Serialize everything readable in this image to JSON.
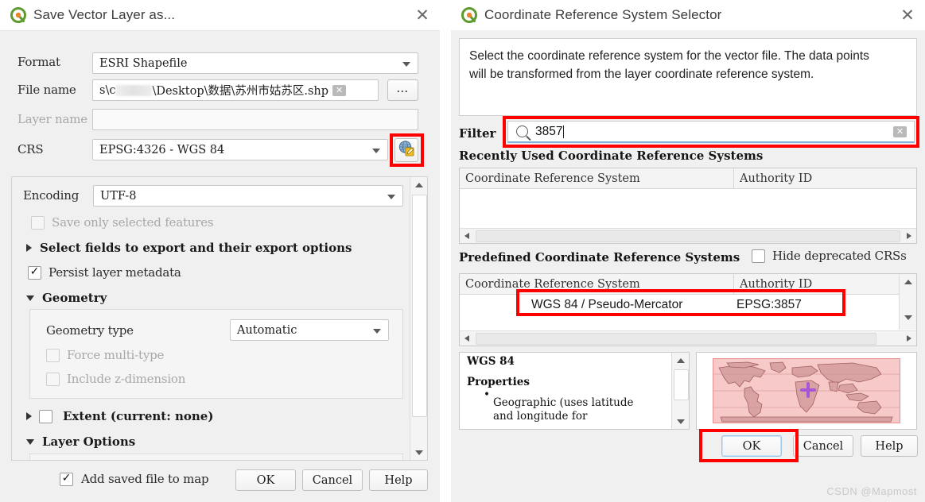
{
  "left_dialog": {
    "title": "Save Vector Layer as...",
    "close_label": "✕",
    "fields": {
      "format_label": "Format",
      "format_value": "ESRI Shapefile",
      "filename_label": "File name",
      "filename_prefix": "s\\c",
      "filename_suffix": "\\Desktop\\数据\\苏州市姑苏区.shp",
      "browse_label": "…",
      "layername_label": "Layer name",
      "layername_value": "",
      "crs_label": "CRS",
      "crs_value": "EPSG:4326 - WGS 84",
      "crs_picker_icon": "globe-pencil-icon"
    },
    "options": {
      "encoding_label": "Encoding",
      "encoding_value": "UTF-8",
      "save_selected_label": "Save only selected features",
      "save_selected_checked": false,
      "select_fields_label": "Select fields to export and their export options",
      "select_fields_expanded": false,
      "persist_metadata_label": "Persist layer metadata",
      "persist_metadata_checked": true,
      "geometry_label": "Geometry",
      "geometry_expanded": true,
      "geometry_type_label": "Geometry type",
      "geometry_type_value": "Automatic",
      "force_multitype_label": "Force multi-type",
      "force_multitype_checked": false,
      "include_z_label": "Include z-dimension",
      "include_z_checked": false,
      "extent_label": "Extent (current: none)",
      "extent_checked": false,
      "extent_expanded": false,
      "layer_options_label": "Layer Options",
      "layer_options_expanded": true
    },
    "footer": {
      "add_saved_label": "Add saved file to map",
      "add_saved_checked": true,
      "ok_label": "OK",
      "cancel_label": "Cancel",
      "help_label": "Help"
    }
  },
  "right_dialog": {
    "title": "Coordinate Reference System Selector",
    "close_label": "✕",
    "description_line1": "Select the coordinate reference system for the vector file. The data points",
    "description_line2": "will be transformed from the layer coordinate reference system.",
    "filter_label": "Filter",
    "filter_value": "3857",
    "filter_search_icon": "search-icon",
    "filter_clear_icon": "clear-icon",
    "recent": {
      "title": "Recently Used Coordinate Reference Systems",
      "columns": [
        "Coordinate Reference System",
        "Authority ID"
      ],
      "rows": []
    },
    "predefined": {
      "title": "Predefined Coordinate Reference Systems",
      "hide_deprecated_label": "Hide deprecated CRSs",
      "hide_deprecated_checked": false,
      "columns": [
        "Coordinate Reference System",
        "Authority ID"
      ],
      "rows": [
        {
          "crs": "WGS 84 / Pseudo-Mercator",
          "authority": "EPSG:3857",
          "selected": true
        }
      ]
    },
    "properties": {
      "name": "WGS 84",
      "heading": "Properties",
      "bullet_line1": "Geographic (uses latitude",
      "bullet_line2": "and longitude for"
    },
    "map_preview": {
      "alt": "world-map-preview",
      "marker_color": "#a855d6",
      "land_color": "#d9a3a3",
      "ocean_color": "#f7c9c9"
    },
    "footer": {
      "ok_label": "OK",
      "cancel_label": "Cancel",
      "help_label": "Help"
    }
  },
  "watermark": "CSDN @Mapmost",
  "colors": {
    "annotation_red": "#ff0000",
    "accent_blue": "#9dc5e8"
  }
}
